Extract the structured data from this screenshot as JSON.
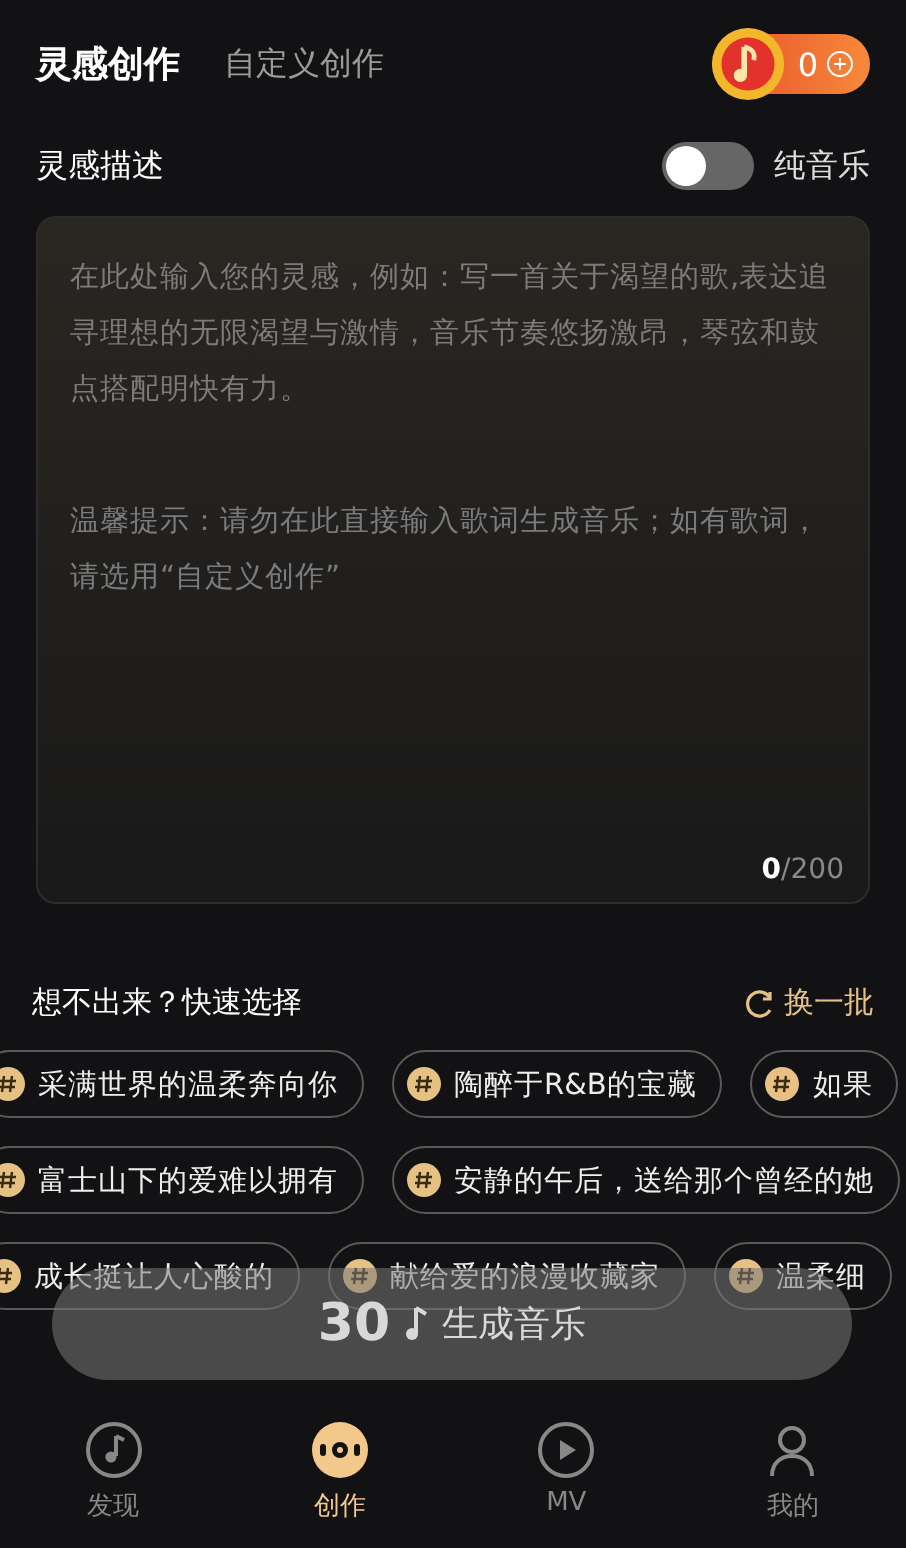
{
  "header": {
    "tabs": [
      {
        "label": "灵感创作",
        "selected": true
      },
      {
        "label": "自定义创作",
        "selected": false
      }
    ],
    "coins": {
      "count": "0"
    }
  },
  "description": {
    "label": "灵感描述",
    "toggle": {
      "label": "纯音乐",
      "on": false
    }
  },
  "prompt": {
    "placeholder": "在此处输入您的灵感，例如：写一首关于渴望的歌,表达追寻理想的无限渴望与激情，音乐节奏悠扬激昂，琴弦和鼓点搭配明快有力。",
    "tip": "温馨提示：请勿在此直接输入歌词生成音乐；如有歌词，请选用“自定义创作”",
    "count": "0",
    "limit": "/200"
  },
  "quick": {
    "title": "想不出来？快速选择",
    "refresh": "换一批",
    "rows": [
      {
        "chips": [
          "采满世界的温柔奔向你",
          "陶醉于R&B的宝藏",
          "如果"
        ]
      },
      {
        "chips": [
          "富士山下的爱难以拥有",
          "安静的午后，送给那个曾经的她"
        ]
      },
      {
        "chips": [
          "成长挺让人心酸的",
          "献给爱的浪漫收藏家",
          "温柔细"
        ]
      }
    ]
  },
  "generate": {
    "seconds": "30",
    "label": "生成音乐"
  },
  "nav": [
    {
      "label": "发现",
      "selected": false
    },
    {
      "label": "创作",
      "selected": true
    },
    {
      "label": "MV",
      "selected": false
    },
    {
      "label": "我的",
      "selected": false
    }
  ]
}
